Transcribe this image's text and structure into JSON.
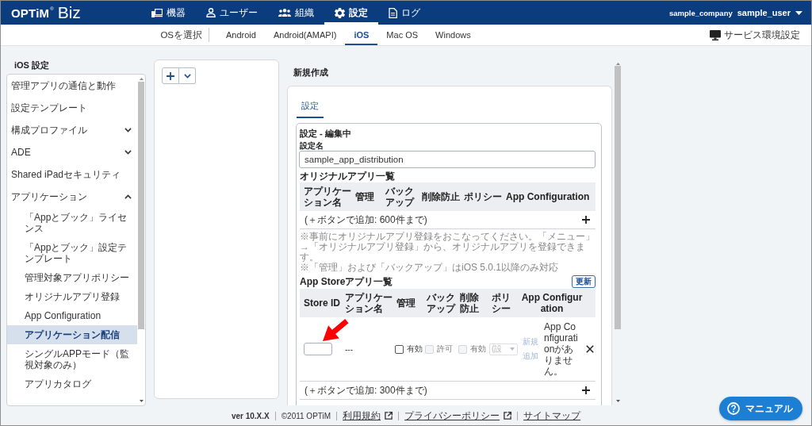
{
  "header": {
    "logo": {
      "brand": "OPTiM",
      "mark": "®",
      "product": "Biz"
    },
    "nav": [
      {
        "label": "機器",
        "selected": false
      },
      {
        "label": "ユーザー",
        "selected": false
      },
      {
        "label": "組織",
        "selected": false
      },
      {
        "label": "設定",
        "selected": true
      },
      {
        "label": "ログ",
        "selected": false
      }
    ],
    "company": "sample_company",
    "user": "sample_user"
  },
  "os_bar": {
    "label": "OSを選択",
    "tabs": [
      {
        "label": "Android",
        "selected": false
      },
      {
        "label": "Android(AMAPI)",
        "selected": false
      },
      {
        "label": "iOS",
        "selected": true
      },
      {
        "label": "Mac OS",
        "selected": false
      },
      {
        "label": "Windows",
        "selected": false
      }
    ],
    "service_settings": "サービス環境設定"
  },
  "sidebar": {
    "title": "iOS 設定",
    "items": [
      {
        "label": "管理アプリの通信と動作",
        "selected": false
      },
      {
        "label": "設定テンプレート",
        "selected": false
      },
      {
        "label": "構成プロファイル",
        "selected": false,
        "expanded": false
      },
      {
        "label": "ADE",
        "selected": false,
        "expanded": false
      },
      {
        "label": "Shared iPadセキュリティ",
        "selected": false
      },
      {
        "label": "アプリケーション",
        "selected": false,
        "expanded": true,
        "children": [
          {
            "label": "「Appとブック」ライセンス",
            "selected": false
          },
          {
            "label": "「Appとブック」設定テンプレート",
            "selected": false
          },
          {
            "label": "管理対象アプリポリシー",
            "selected": false
          },
          {
            "label": "オリジナルアプリ登録",
            "selected": false
          },
          {
            "label": "App Configuration",
            "selected": false
          },
          {
            "label": "アプリケーション配信",
            "selected": true
          },
          {
            "label": "シングルAPPモード（監視対象のみ）",
            "selected": false
          },
          {
            "label": "アプリカタログ",
            "selected": false
          }
        ]
      }
    ]
  },
  "editor": {
    "title": "新規作成",
    "tabs": [
      {
        "label": "設定",
        "selected": true
      }
    ],
    "section_title": "設定 - 編集中",
    "name_field": {
      "label": "設定名",
      "value": "sample_app_distribution"
    },
    "original_apps": {
      "title": "オリジナルアプリ一覧",
      "columns": [
        "アプリケーション名",
        "管理",
        "バックアップ",
        "削除防止",
        "ポリシー",
        "App Configuration"
      ],
      "add_hint": "(＋ボタンで追加: 600件まで)",
      "notes": [
        "※事前にオリジナルアプリ登録をおこなってください。「メニュー」→「オリジナルアプリ登録」から、オリジナルアプリを登録できます。",
        "※「管理」および「バックアップ」はiOS 5.0.1以降のみ対応"
      ]
    },
    "store_apps": {
      "title": "App Storeアプリ一覧",
      "refresh_button": "更新",
      "columns": [
        "Store ID",
        "アプリケーション名",
        "管理",
        "バックアップ",
        "削除防止",
        "ポリシー",
        "App Configuration"
      ],
      "rows": [
        {
          "app_name": "---",
          "manage": {
            "label": "有効",
            "checked": false,
            "disabled": false
          },
          "backup": {
            "label": "許可",
            "checked": false,
            "disabled": true
          },
          "delete_protection": {
            "label": "有効",
            "checked": false,
            "disabled": true
          },
          "policy": {
            "value": "(設",
            "disabled": true
          },
          "config_link": {
            "label": "新規追加",
            "disabled": true
          },
          "app_config": "App Configurationがありません。"
        }
      ],
      "add_hint": "(＋ボタンで追加: 300件まで)"
    }
  },
  "footer": {
    "version": "ver 10.X.X",
    "copyright": "©2011 OPTiM",
    "links": [
      {
        "label": "利用規約",
        "external": true
      },
      {
        "label": "プライバシーポリシー",
        "external": true
      },
      {
        "label": "サイトマップ",
        "external": false
      }
    ]
  },
  "help_button": {
    "label": "マニュアル"
  },
  "annotations": [
    {
      "kind": "arrow"
    }
  ]
}
